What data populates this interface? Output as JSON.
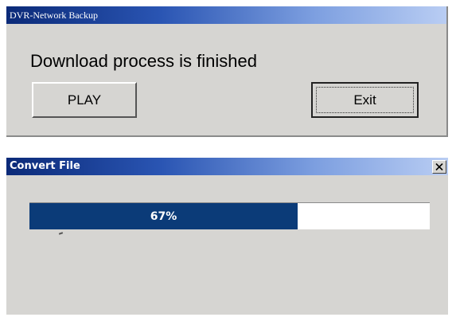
{
  "backup_dialog": {
    "title": "DVR-Network Backup",
    "message": "Download process is finished",
    "play_label": "PLAY",
    "exit_label": "Exit"
  },
  "convert_dialog": {
    "title": "Convert File",
    "progress_value": 0.67,
    "progress_label": "67%",
    "close_icon": "close-icon"
  },
  "colors": {
    "titlebar_start": "#0b2a78",
    "titlebar_end": "#b9cdf3",
    "progress_fill": "#0b3b78",
    "window_bg": "#d6d5d2"
  }
}
